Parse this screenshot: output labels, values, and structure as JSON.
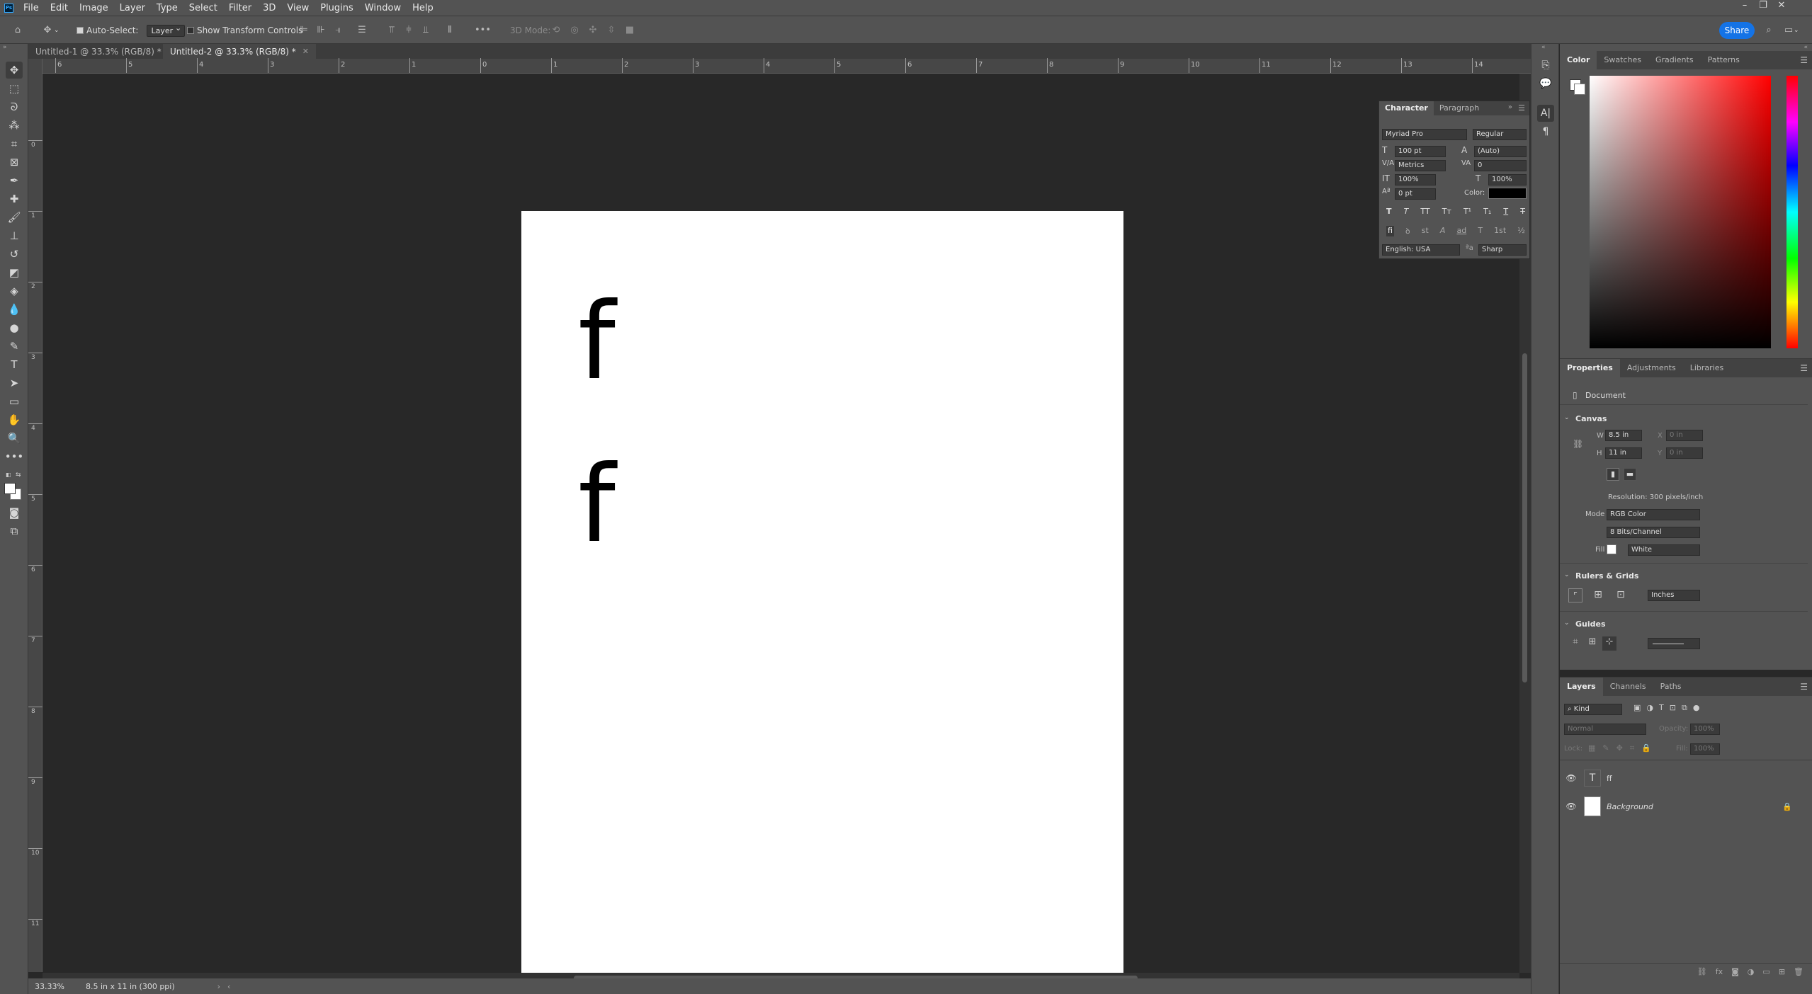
{
  "menubar": {
    "logo": "Ps",
    "items": [
      "File",
      "Edit",
      "Image",
      "Layer",
      "Type",
      "Select",
      "Filter",
      "3D",
      "View",
      "Plugins",
      "Window",
      "Help"
    ]
  },
  "options": {
    "auto_select_label": "Auto-Select:",
    "auto_select_value": "Layer",
    "transform_label": "Show Transform Controls",
    "mode_3d_label": "3D Mode:",
    "share_label": "Share"
  },
  "tabs": [
    {
      "label": "Untitled-1 @ 33.3% (RGB/8) *"
    },
    {
      "label": "Untitled-2 @ 33.3% (RGB/8) *"
    }
  ],
  "ruler": {
    "top": [
      "6",
      "5",
      "4",
      "3",
      "2",
      "1",
      "0",
      "1",
      "2",
      "3",
      "4",
      "5",
      "6",
      "7",
      "8",
      "9",
      "10",
      "11",
      "12",
      "13",
      "14"
    ],
    "left": [
      "0",
      "1",
      "2",
      "3",
      "4",
      "5",
      "6",
      "7",
      "8",
      "9",
      "10",
      "11"
    ]
  },
  "canvas": {
    "glyph1": "f",
    "glyph2": "f"
  },
  "status": {
    "zoom": "33.33%",
    "doc_info": "8.5 in x 11 in (300 ppi)"
  },
  "character": {
    "tab_character": "Character",
    "tab_paragraph": "Paragraph",
    "font_family": "Myriad Pro",
    "font_style": "Regular",
    "size": "100 pt",
    "leading": "(Auto)",
    "kerning": "Metrics",
    "tracking": "0",
    "vscale": "100%",
    "hscale": "100%",
    "baseline": "0 pt",
    "color_label": "Color:",
    "language": "English: USA",
    "antialias": "Sharp",
    "style_buttons": [
      "T",
      "T",
      "TT",
      "Tт",
      "T¹",
      "T₁",
      "T",
      "T"
    ],
    "ot_buttons": [
      "fi",
      "ꝺ",
      "st",
      "A",
      "ad",
      "T",
      "1st",
      "½"
    ]
  },
  "color_panel": {
    "tabs": [
      "Color",
      "Swatches",
      "Gradients",
      "Patterns"
    ]
  },
  "properties": {
    "tabs": [
      "Properties",
      "Adjustments",
      "Libraries"
    ],
    "doc_label": "Document",
    "canvas_title": "Canvas",
    "w_label": "W",
    "w_value": "8.5 in",
    "h_label": "H",
    "h_value": "11 in",
    "x_label": "X",
    "x_value": "0 in",
    "y_label": "Y",
    "y_value": "0 in",
    "resolution": "Resolution: 300 pixels/inch",
    "mode_label": "Mode",
    "mode_value": "RGB Color",
    "depth_value": "8 Bits/Channel",
    "fill_label": "Fill",
    "fill_value": "White",
    "rulers_title": "Rulers & Grids",
    "units_value": "Inches",
    "guides_title": "Guides"
  },
  "layers": {
    "tabs": [
      "Layers",
      "Channels",
      "Paths"
    ],
    "filter_kind": "Kind",
    "blend_mode": "Normal",
    "opacity_label": "Opacity:",
    "opacity_value": "100%",
    "lock_label": "Lock:",
    "fill_label": "Fill:",
    "fill_value": "100%",
    "items": [
      {
        "name": "ff",
        "type": "text"
      },
      {
        "name": "Background",
        "type": "pixel"
      }
    ]
  },
  "colors": {
    "accent": "#1473e6",
    "panel_bg": "#535353",
    "canvas_bg": "#282828"
  }
}
